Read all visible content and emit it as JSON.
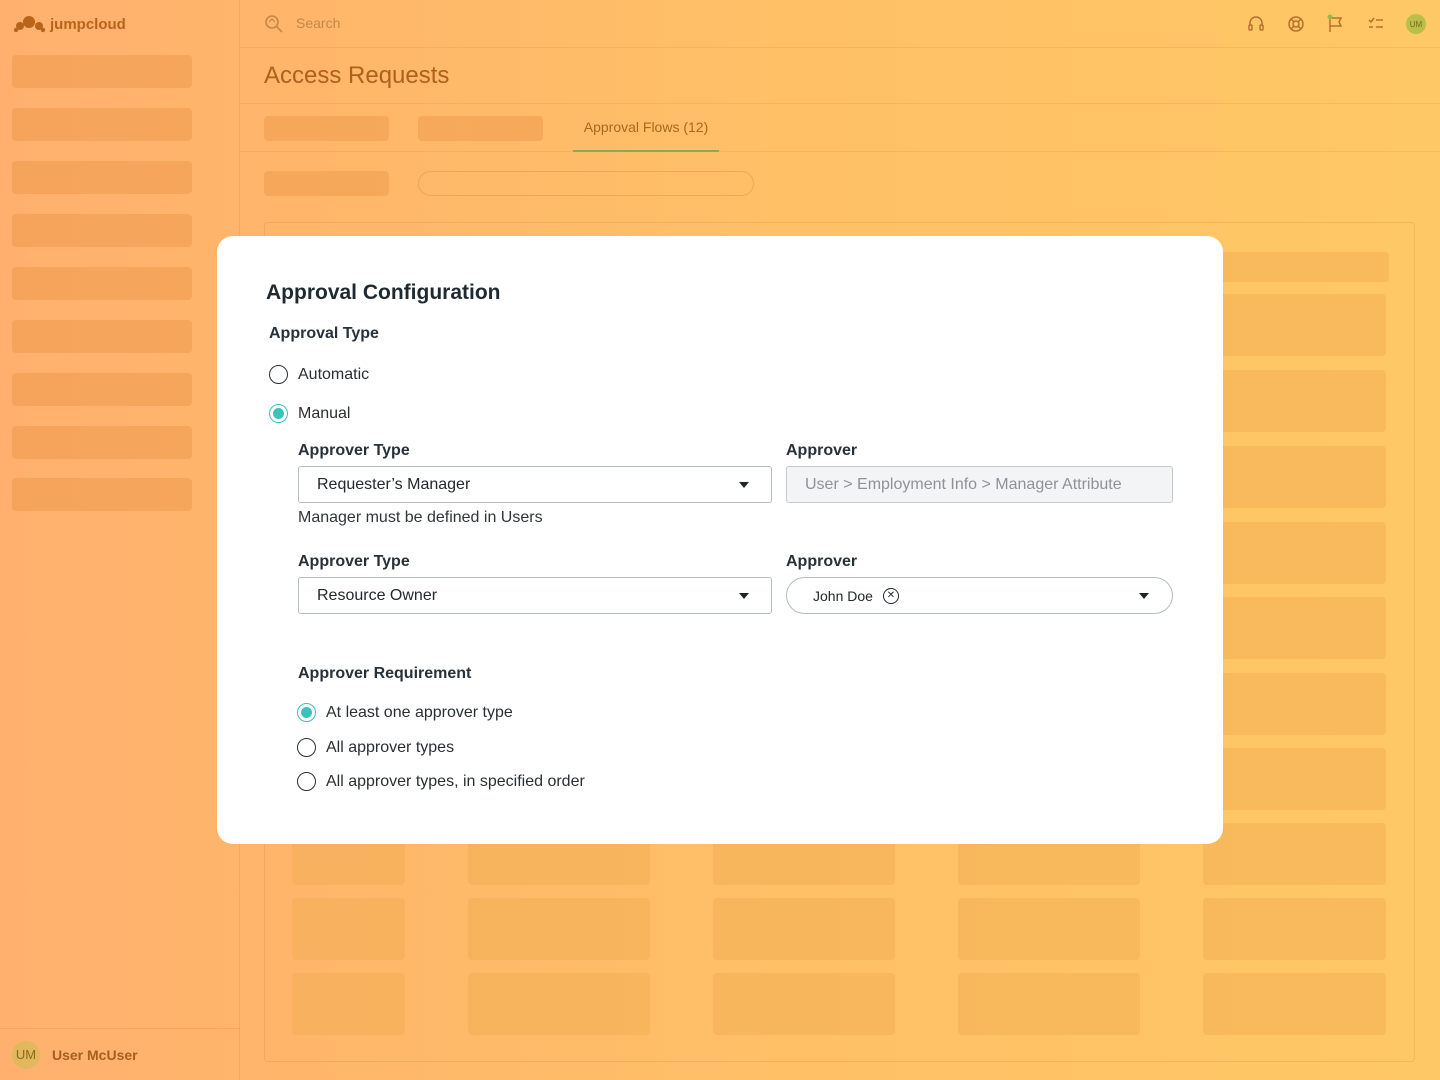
{
  "brand": {
    "name": "jumpcloud"
  },
  "topbar": {
    "search_placeholder": "Search",
    "avatar_initials": "UM"
  },
  "sidebar": {
    "user": {
      "initials": "UM",
      "name": "User McUser"
    }
  },
  "page": {
    "title": "Access Requests",
    "tabs": {
      "active_label": "Approval Flows (12)"
    }
  },
  "modal": {
    "title": "Approval Configuration",
    "approval_type": {
      "label": "Approval Type",
      "options": [
        {
          "label": "Automatic",
          "checked": false
        },
        {
          "label": "Manual",
          "checked": true
        }
      ]
    },
    "approver_rows": [
      {
        "type_label": "Approver Type",
        "type_value": "Requester’s Manager",
        "approver_label": "Approver",
        "approver_value": "User > Employment Info > Manager Attribute",
        "helper": "Manager must be defined in Users"
      },
      {
        "type_label": "Approver Type",
        "type_value": "Resource Owner",
        "approver_label": "Approver",
        "approver_chip": "John Doe"
      }
    ],
    "requirement": {
      "label": "Approver Requirement",
      "options": [
        {
          "label": "At least one approver type",
          "checked": true
        },
        {
          "label": "All approver types",
          "checked": false
        },
        {
          "label": "All approver types, in specified order",
          "checked": false
        }
      ]
    }
  },
  "colors": {
    "accent": "#3cc1bf",
    "brand": "#b0601c"
  }
}
